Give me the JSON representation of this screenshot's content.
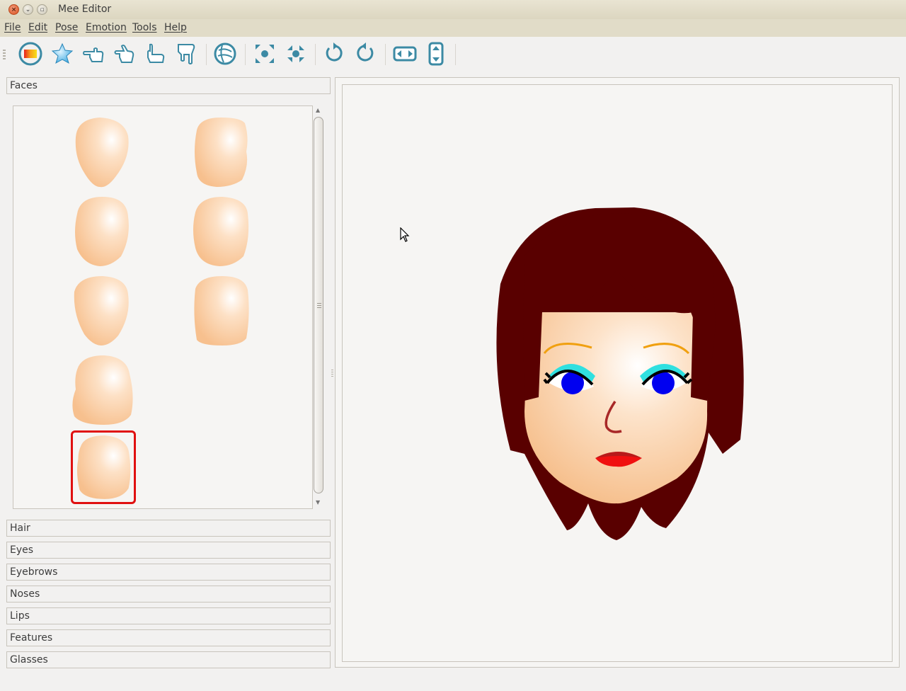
{
  "window": {
    "title": "Mee Editor",
    "controls": [
      "close",
      "minimize",
      "maximize"
    ]
  },
  "menubar": {
    "items": [
      {
        "label": "File"
      },
      {
        "label": "Edit"
      },
      {
        "label": "Pose"
      },
      {
        "label": "Emotion"
      },
      {
        "label": "Tools"
      },
      {
        "label": "Help"
      }
    ]
  },
  "toolbar": {
    "buttons": [
      {
        "icon": "color-palette-icon"
      },
      {
        "icon": "star-icon"
      },
      {
        "icon": "hand-point-left-icon"
      },
      {
        "icon": "hand-point-left-alt-icon"
      },
      {
        "icon": "hand-thumb-icon"
      },
      {
        "icon": "hand-point-down-icon"
      },
      {
        "icon": "globe-icon"
      },
      {
        "icon": "zoom-in-icon"
      },
      {
        "icon": "zoom-out-icon"
      },
      {
        "icon": "rotate-left-icon"
      },
      {
        "icon": "rotate-right-icon"
      },
      {
        "icon": "flip-horizontal-icon"
      },
      {
        "icon": "flip-vertical-icon"
      }
    ]
  },
  "left_panel": {
    "expanded_section": "Faces",
    "face_thumbnails": {
      "count": 8,
      "selected_index": 7
    },
    "collapsed_sections": [
      {
        "label": "Hair"
      },
      {
        "label": "Eyes"
      },
      {
        "label": "Eyebrows"
      },
      {
        "label": "Noses"
      },
      {
        "label": "Lips"
      },
      {
        "label": "Features"
      },
      {
        "label": "Glasses"
      }
    ]
  },
  "avatar_colors": {
    "hair": "#5a0000",
    "skin": "#f7c08e",
    "eyes": "#0000f0",
    "eyeshadow": "#30e0e0",
    "eyebrows": "#f0a010",
    "nose": "#a82828",
    "lips": "#f01010",
    "selection": "#e01010"
  }
}
